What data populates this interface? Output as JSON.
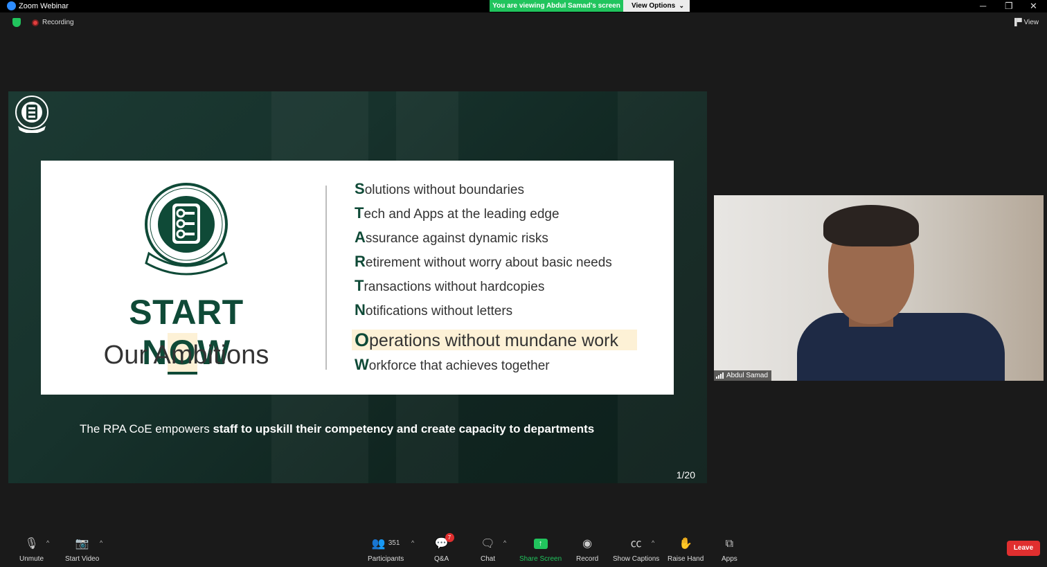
{
  "window": {
    "title": "Zoom Webinar",
    "minimize": "─",
    "restore": "❐",
    "close": "✕"
  },
  "banner": {
    "viewing": "You are viewing Abdul Samad's screen",
    "view_options": "View Options",
    "chevron": "⌄"
  },
  "status": {
    "recording": "Recording",
    "view": "View"
  },
  "slide": {
    "start": "START N",
    "o": "O",
    "w": "W",
    "subtitle": "Our Ambitions",
    "items": [
      {
        "cap": "S",
        "rest": "olutions without boundaries"
      },
      {
        "cap": "T",
        "rest": "ech and Apps at the leading edge"
      },
      {
        "cap": "A",
        "rest": "ssurance against dynamic risks"
      },
      {
        "cap": "R",
        "rest": "etirement without worry about basic needs"
      },
      {
        "cap": "T",
        "rest": "ransactions without hardcopies"
      },
      {
        "cap": "N",
        "rest": "otifications without letters"
      },
      {
        "cap": "O",
        "rest": "perations without mundane work"
      },
      {
        "cap": "W",
        "rest": "orkforce that achieves together"
      }
    ],
    "caption_plain": "The RPA CoE empowers ",
    "caption_bold": "staff to upskill their competency and create capacity to departments",
    "page": "1/20"
  },
  "video": {
    "name": "Abdul Samad"
  },
  "toolbar": {
    "unmute": "Unmute",
    "start_video": "Start Video",
    "participants": "Participants",
    "participant_count": "351",
    "qa": "Q&A",
    "qa_badge": "7",
    "chat": "Chat",
    "share_screen": "Share Screen",
    "record": "Record",
    "show_captions": "Show Captions",
    "raise_hand": "Raise Hand",
    "apps": "Apps",
    "leave": "Leave",
    "caret": "^"
  },
  "colors": {
    "brand_green": "#0f4a37",
    "zoom_green": "#21c45d",
    "leave_red": "#e02f2f",
    "highlight": "#fdf1d6"
  }
}
